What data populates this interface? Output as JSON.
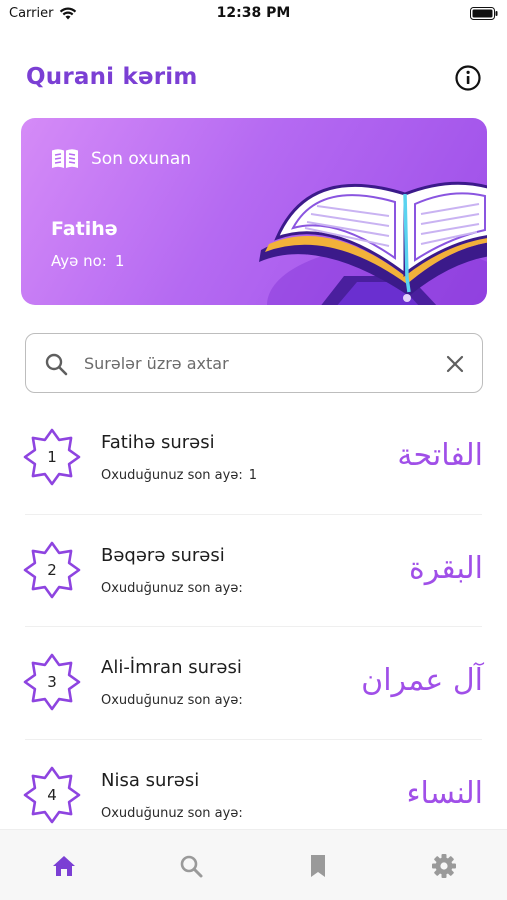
{
  "status_bar": {
    "carrier": "Carrier",
    "time": "12:38 PM"
  },
  "header": {
    "title": "Qurani kərim",
    "info_icon": "info-icon"
  },
  "last_read": {
    "label": "Son oxunan",
    "surah": "Fatihə",
    "ayah_label": "Ayə no:",
    "ayah_value": "1",
    "icon": "open-book-icon"
  },
  "search": {
    "placeholder": "Surələr üzrə axtar",
    "value": ""
  },
  "surahs": [
    {
      "number": "1",
      "name": "Fatihə surəsi",
      "last_read_label": "Oxuduğunuz son ayə:",
      "last_read_value": "1",
      "arabic": "الفاتحة"
    },
    {
      "number": "2",
      "name": "Bəqərə surəsi",
      "last_read_label": "Oxuduğunuz son ayə:",
      "last_read_value": "",
      "arabic": "البقرة"
    },
    {
      "number": "3",
      "name": "Ali-İmran surəsi",
      "last_read_label": "Oxuduğunuz son ayə:",
      "last_read_value": "",
      "arabic": "آل عمران"
    },
    {
      "number": "4",
      "name": "Nisa surəsi",
      "last_read_label": "Oxuduğunuz son ayə:",
      "last_read_value": "",
      "arabic": "النساء"
    }
  ],
  "bottom_nav": [
    {
      "icon": "home-icon",
      "active": true
    },
    {
      "icon": "search-icon",
      "active": false
    },
    {
      "icon": "bookmark-icon",
      "active": false
    },
    {
      "icon": "settings-icon",
      "active": false
    }
  ],
  "colors": {
    "accent": "#7b3fd4",
    "arabic": "#a04fe8",
    "card_start": "#d58bf7",
    "card_end": "#9d4ee8",
    "nav_inactive": "#9a9a9a"
  }
}
